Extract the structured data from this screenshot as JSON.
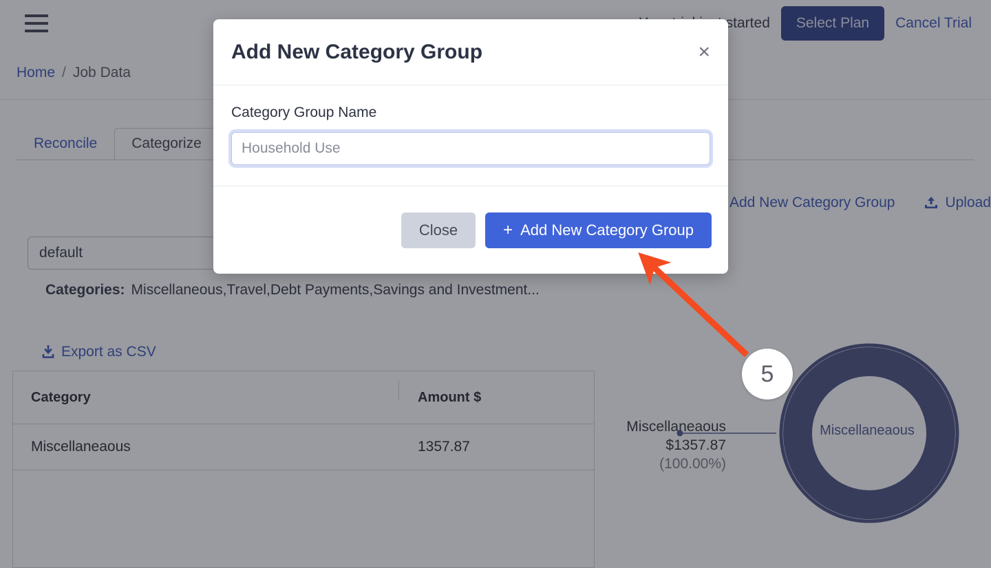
{
  "topbar": {
    "menu_icon": "hamburger-icon",
    "trial_text": "Your trial just started",
    "select_plan_label": "Select Plan",
    "cancel_trial_label": "Cancel Trial"
  },
  "breadcrumb": {
    "home": "Home",
    "separator": "/",
    "current": "Job Data"
  },
  "tabs": [
    {
      "label": "Reconcile",
      "active": false
    },
    {
      "label": "Categorize",
      "active": true
    }
  ],
  "toolbar": {
    "add_group_label": "Add New Category Group",
    "upload_label": "Upload",
    "upload_icon": "upload-icon"
  },
  "filters": {
    "selected_option": "default",
    "categories_label": "Categories:",
    "categories_value": "Miscellaneous,Travel,Debt Payments,Savings and Investment..."
  },
  "export": {
    "label": "Export as CSV",
    "icon": "download-icon"
  },
  "table": {
    "columns": [
      "Category",
      "Amount $"
    ],
    "rows": [
      {
        "category": "Miscellaneaous",
        "amount": "1357.87"
      }
    ]
  },
  "chart_data": {
    "type": "pie",
    "title": "",
    "categories": [
      "Miscellaneaous"
    ],
    "values": [
      1357.87
    ],
    "percentages": [
      "100.00%"
    ],
    "colors": [
      "#464c7d"
    ],
    "center_label": "Miscellaneaous",
    "callout": {
      "name": "Miscellaneaous",
      "value": "$1357.87",
      "percent": "(100.00%)"
    },
    "legend": "none",
    "donut": true
  },
  "modal": {
    "title": "Add New Category Group",
    "close_icon": "×",
    "field_label": "Category Group Name",
    "field_value": "",
    "field_placeholder": "Household Use",
    "close_button": "Close",
    "submit_button": "Add New Category Group",
    "submit_icon": "+"
  },
  "annotation": {
    "step_number": "5",
    "arrow_color": "#f44b21"
  }
}
